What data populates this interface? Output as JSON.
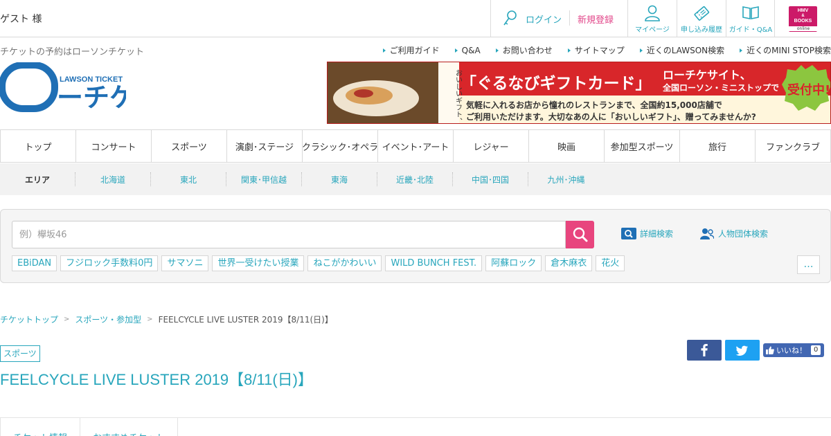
{
  "header": {
    "guest_text": "ゲスト 様",
    "login": "ログイン",
    "register": "新規登録",
    "buttons": [
      {
        "label": "マイページ",
        "icon": "person-icon"
      },
      {
        "label": "申し込み履歴",
        "icon": "ticket-icon"
      },
      {
        "label": "ガイド・Q&A",
        "icon": "book-icon"
      }
    ],
    "hmv": {
      "line1": "HMV",
      "line2": "&",
      "line3": "BOOKS",
      "sub": "online"
    }
  },
  "tagline": "チケットの予約はローソンチケット",
  "util_nav": [
    "ご利用ガイド",
    "Q&A",
    "お問い合わせ",
    "サイトマップ",
    "近くのLAWSON検索",
    "近くのMINI STOP検索"
  ],
  "logo": {
    "main_o": "ロ",
    "main_rest": "ーチケ",
    "sub": "LAWSON TICKET"
  },
  "banner": {
    "vertical_text": "おいしいギフト、できました。",
    "headline": "「ぐるなびギフトカード」",
    "side_title": "ローチケサイト、",
    "side_sub": "全国ローソン・ミニストップで",
    "badge": "受付中!",
    "body_line1": "気軽に入れるお店から憧れのレストランまで、全国約15,000店舗で",
    "body_line2": "ご利用いただけます。大切なあの人に「おいしいギフト」、贈ってみませんか?"
  },
  "genre_nav": [
    "トップ",
    "コンサート",
    "スポーツ",
    "演劇･ステージ",
    "クラシック･オペラ",
    "イベント･アート",
    "レジャー",
    "映画",
    "参加型スポーツ",
    "旅行",
    "ファンクラブ"
  ],
  "area_nav": {
    "head": "エリア",
    "items": [
      "北海道",
      "東北",
      "関東･甲信越",
      "東海",
      "近畿･北陸",
      "中国･四国",
      "九州･沖縄"
    ]
  },
  "search": {
    "placeholder": "例）欅坂46",
    "advanced": "詳細検索",
    "person": "人物団体検索",
    "keywords": [
      "EBiDAN",
      "フジロック手数料0円",
      "サマソニ",
      "世界一受けたい授業",
      "ねこがかわいい",
      "WILD BUNCH FEST.",
      "阿蘇ロック",
      "倉木麻衣",
      "花火"
    ],
    "more": "…"
  },
  "breadcrumb": {
    "items": [
      "チケットトップ",
      "スポーツ・参加型"
    ],
    "separator": ">",
    "current": "FEELCYCLE LIVE LUSTER 2019【8/11(日)】"
  },
  "category_badge": "スポーツ",
  "page_title": "FEELCYCLE LIVE LUSTER 2019【8/11(日)】",
  "social": {
    "like_label": "いいね！",
    "like_count": "0"
  },
  "tabs": [
    "チケット情報",
    "おすすめチケット"
  ],
  "colors": {
    "accent": "#28a6bc",
    "pink": "#e8457e",
    "brand_blue": "#1f6fb5"
  }
}
